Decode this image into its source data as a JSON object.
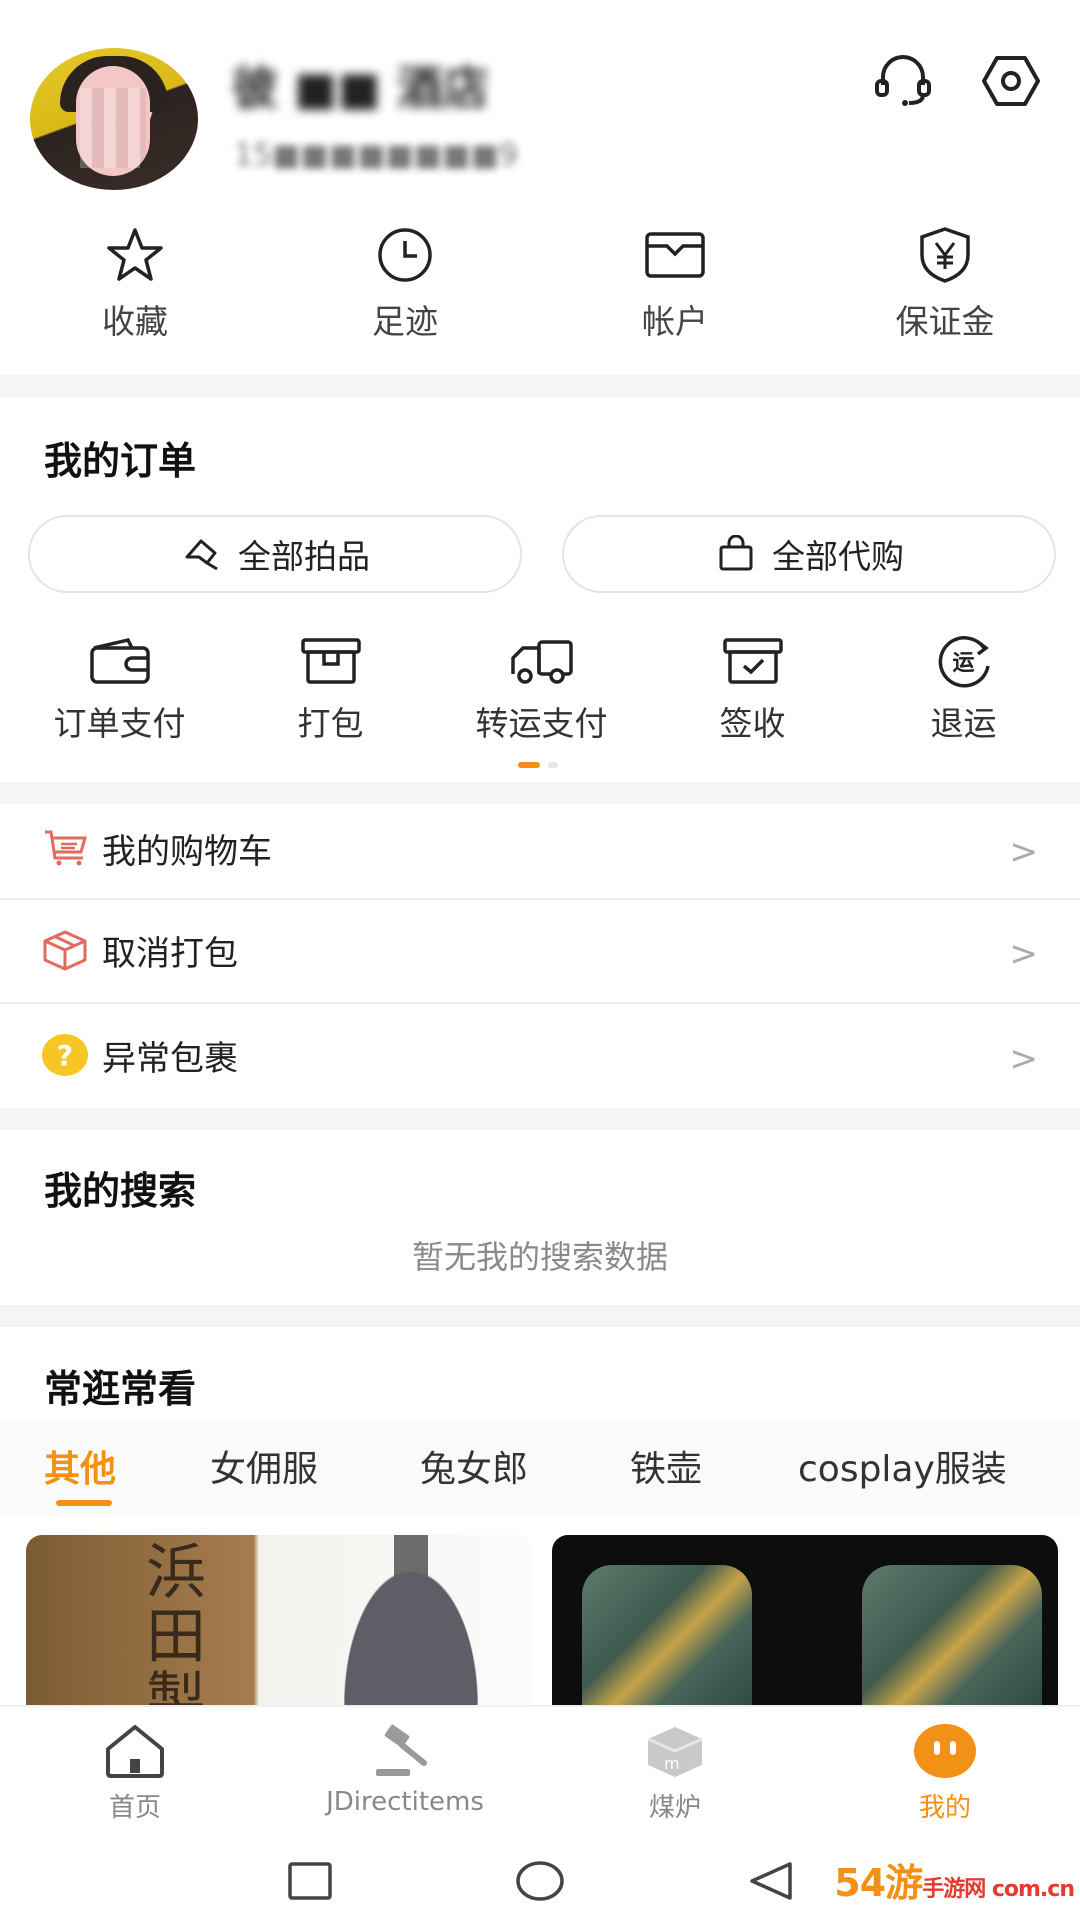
{
  "profile": {
    "name": "彼 ■■ 酒店",
    "phone": "15■■■■■■■■9"
  },
  "header_icons": {
    "service": "headset-icon",
    "settings": "gear-icon"
  },
  "quick": [
    {
      "label": "收藏",
      "icon": "star-icon"
    },
    {
      "label": "足迹",
      "icon": "clock-icon"
    },
    {
      "label": "帐户",
      "icon": "wallet-icon"
    },
    {
      "label": "保证金",
      "icon": "shield-yen-icon"
    }
  ],
  "orders": {
    "title": "我的订单",
    "all_auction": "全部拍品",
    "all_proxy": "全部代购",
    "items": [
      {
        "label": "订单支付",
        "icon": "wallet-card-icon"
      },
      {
        "label": "打包",
        "icon": "box-icon"
      },
      {
        "label": "转运支付",
        "icon": "truck-icon"
      },
      {
        "label": "签收",
        "icon": "check-box-icon"
      },
      {
        "label": "退运",
        "icon": "return-icon",
        "glyph": "运"
      }
    ]
  },
  "links": [
    {
      "label": "我的购物车",
      "icon": "cart-icon"
    },
    {
      "label": "取消打包",
      "icon": "package-icon"
    },
    {
      "label": "异常包裹",
      "icon": "question-icon",
      "glyph": "?"
    }
  ],
  "chevron": ">",
  "search": {
    "title": "我的搜索",
    "empty": "暂无我的搜索数据"
  },
  "browse": {
    "title": "常逛常看",
    "tabs": [
      "其他",
      "女佣服",
      "兔女郎",
      "铁壶",
      "cosplay服装"
    ],
    "active_tab": 0,
    "card1_glyphs": "浜田製"
  },
  "bottom_nav": [
    {
      "label": "首页",
      "icon": "home-icon"
    },
    {
      "label": "JDirectitems",
      "icon": "gavel-icon"
    },
    {
      "label": "煤炉",
      "icon": "mercari-box-icon"
    },
    {
      "label": "我的",
      "icon": "profile-face-icon"
    }
  ],
  "watermark": {
    "main": "54游",
    "sub": "手游网 com.cn"
  },
  "colors": {
    "accent": "#f39016",
    "gap": "#f5f5f5",
    "muted": "#8a8a8a"
  }
}
